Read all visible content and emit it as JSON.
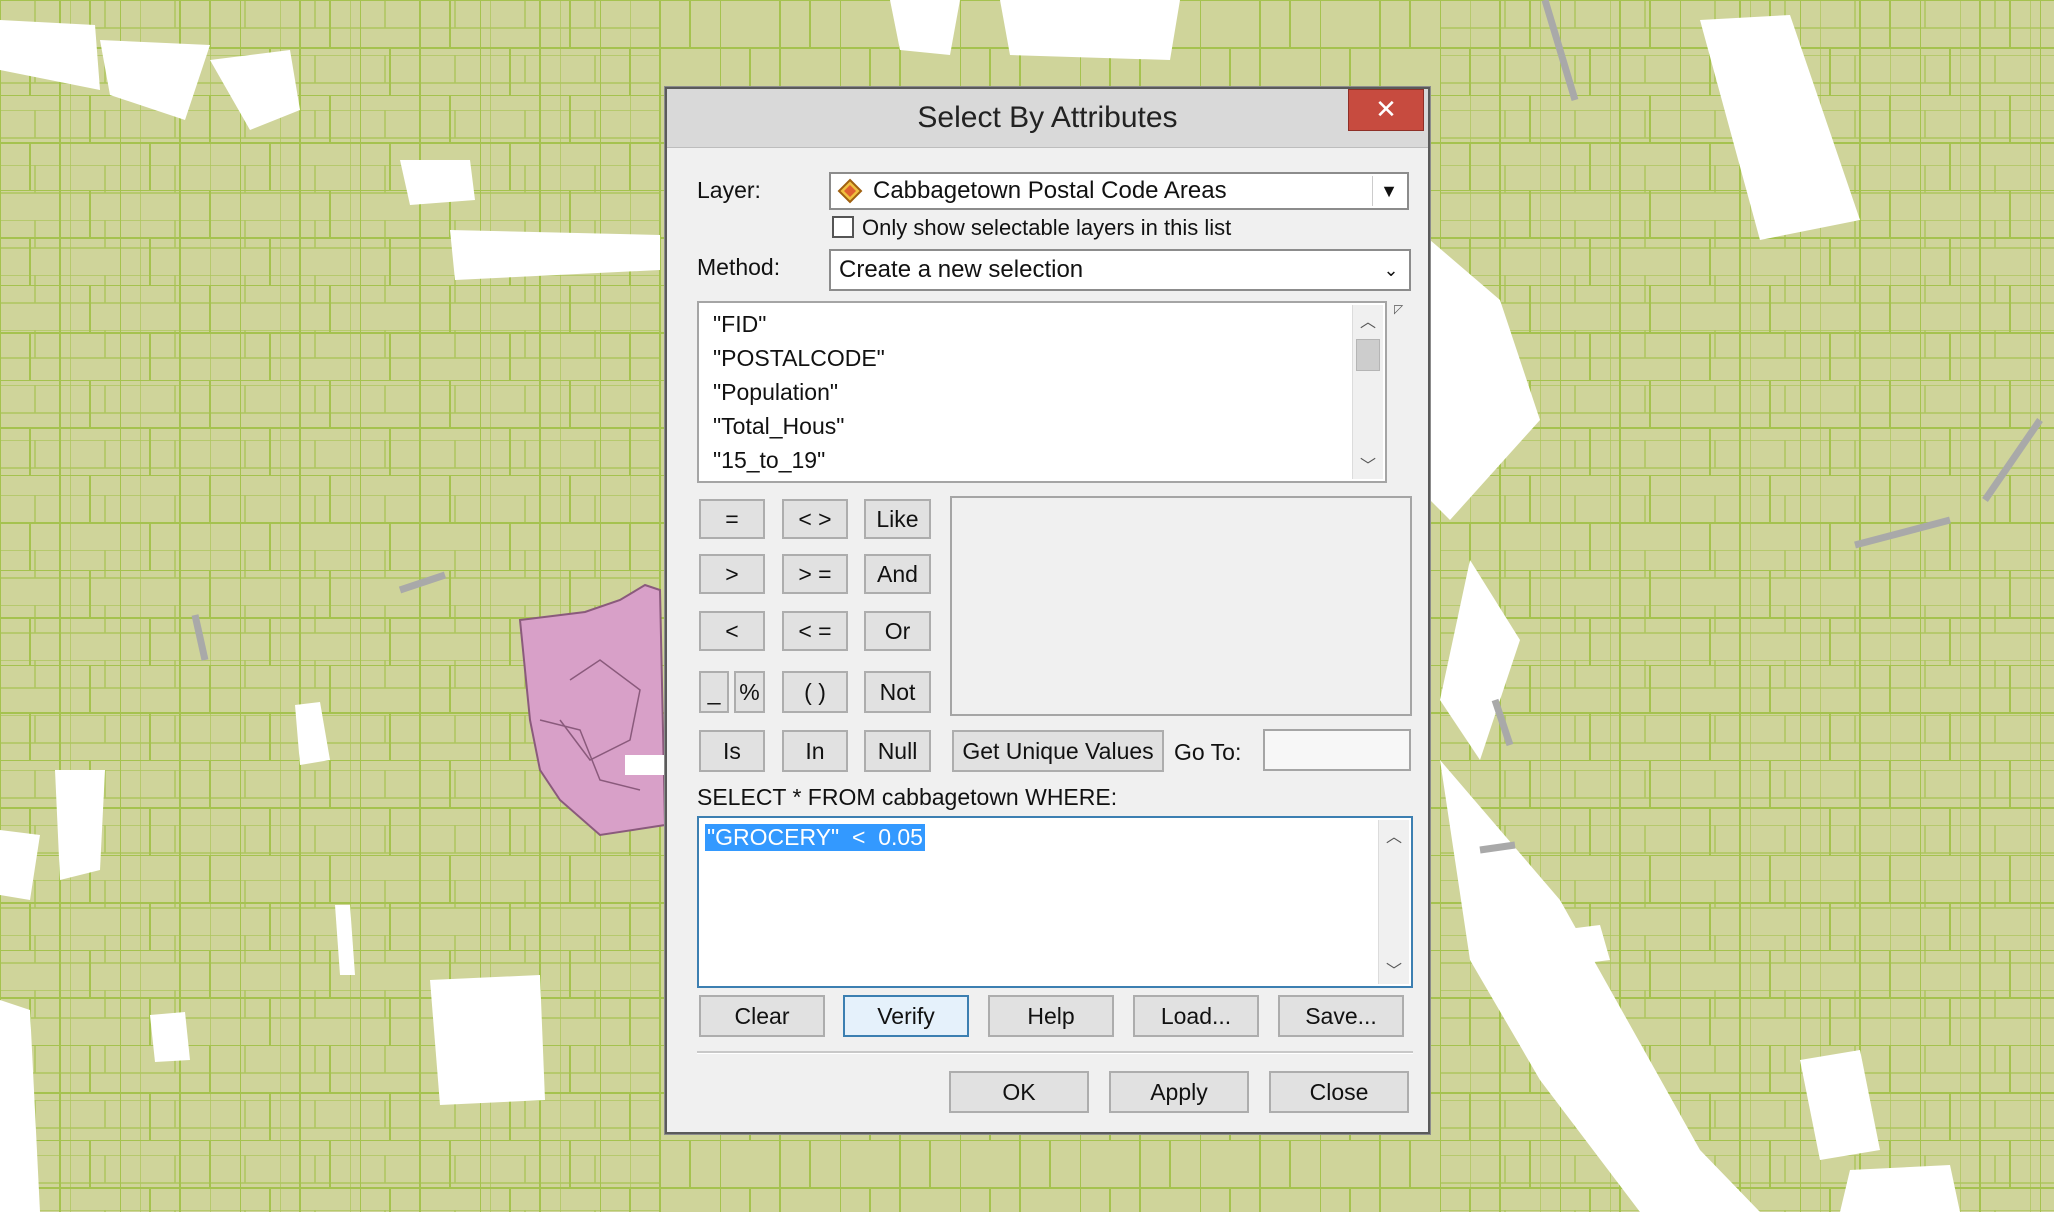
{
  "dialog": {
    "title": "Select By Attributes",
    "close_symbol": "✕",
    "layer_label": "Layer:",
    "layer_value": "Cabbagetown Postal Code Areas",
    "only_selectable_label": "Only show selectable layers in this list",
    "only_selectable_checked": false,
    "method_label": "Method:",
    "method_value": "Create a new selection",
    "fields": [
      "\"FID\"",
      "\"POSTALCODE\"",
      "\"Population\"",
      "\"Total_Hous\"",
      "\"15_to_19\""
    ],
    "operators": {
      "eq": "=",
      "ne": "< >",
      "like": "Like",
      "gt": ">",
      "ge": "> =",
      "and": "And",
      "lt": "<",
      "le": "< =",
      "or": "Or",
      "underscore": "_",
      "percent": "%",
      "parens": "( )",
      "not": "Not",
      "is": "Is",
      "in": "In",
      "null": "Null"
    },
    "get_unique_values_label": "Get Unique Values",
    "goto_label": "Go To:",
    "goto_value": "",
    "sql_prefix": "SELECT * FROM cabbagetown WHERE:",
    "sql_expression": "\"GROCERY\"  <  0.05",
    "buttons": {
      "clear": "Clear",
      "verify": "Verify",
      "help": "Help",
      "load": "Load...",
      "save": "Save..."
    },
    "footer": {
      "ok": "OK",
      "apply": "Apply",
      "close": "Close"
    }
  },
  "icons": {
    "layer": "polygon-layer-icon",
    "dropdown": "chevron-down-icon",
    "scroll_up": "scroll-up-icon",
    "scroll_down": "scroll-down-icon",
    "close": "close-icon"
  },
  "colors": {
    "map_fill": "#cfd49a",
    "map_lines": "#9fbf3f",
    "selection_fill": "#d9a0c8",
    "close_button": "#c74b3f",
    "highlight": "#3399ff"
  }
}
